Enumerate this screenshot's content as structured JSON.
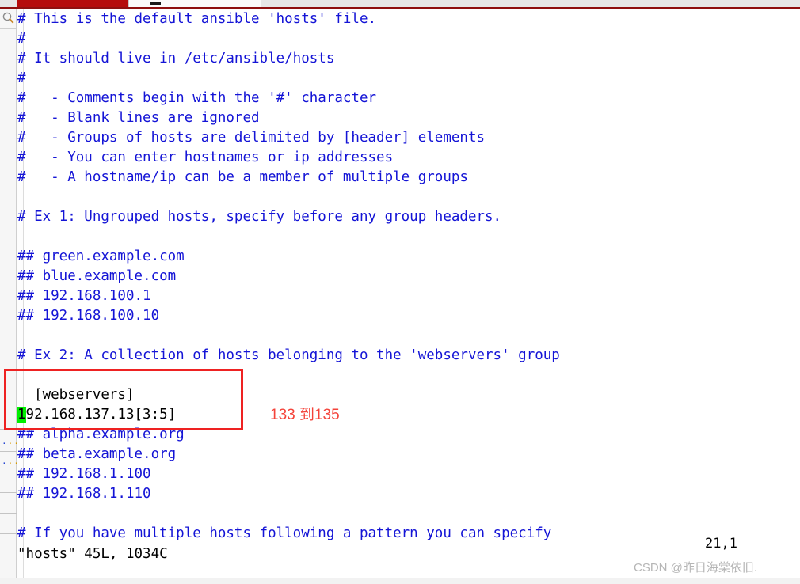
{
  "window": {
    "tab_bar": {
      "active_tab_label": "",
      "inactive_tab_label": "",
      "accent_color": "#b50c0c"
    }
  },
  "left_rail": {
    "search_icon_name": "magnifier-icon",
    "fold_markers": [
      "...",
      "..."
    ]
  },
  "editor": {
    "file_type": "ansible-hosts",
    "text_color": "#1414d6",
    "edited_text_color": "#000000",
    "cursor_color": "#00ef00",
    "lines": [
      {
        "text": "# This is the default ansible 'hosts' file.",
        "color": "blue"
      },
      {
        "text": "#",
        "color": "blue"
      },
      {
        "text": "# It should live in /etc/ansible/hosts",
        "color": "blue"
      },
      {
        "text": "#",
        "color": "blue"
      },
      {
        "text": "#   - Comments begin with the '#' character",
        "color": "blue"
      },
      {
        "text": "#   - Blank lines are ignored",
        "color": "blue"
      },
      {
        "text": "#   - Groups of hosts are delimited by [header] elements",
        "color": "blue"
      },
      {
        "text": "#   - You can enter hostnames or ip addresses",
        "color": "blue"
      },
      {
        "text": "#   - A hostname/ip can be a member of multiple groups",
        "color": "blue"
      },
      {
        "text": "",
        "color": "blue"
      },
      {
        "text": "# Ex 1: Ungrouped hosts, specify before any group headers.",
        "color": "blue"
      },
      {
        "text": "",
        "color": "blue"
      },
      {
        "text": "## green.example.com",
        "color": "blue"
      },
      {
        "text": "## blue.example.com",
        "color": "blue"
      },
      {
        "text": "## 192.168.100.1",
        "color": "blue"
      },
      {
        "text": "## 192.168.100.10",
        "color": "blue"
      },
      {
        "text": "",
        "color": "blue"
      },
      {
        "text": "# Ex 2: A collection of hosts belonging to the 'webservers' group",
        "color": "blue"
      },
      {
        "text": "",
        "color": "blue"
      },
      {
        "text": "  [webservers]",
        "color": "black"
      },
      {
        "text": "192.168.137.13[3:5]",
        "color": "black",
        "cursor_at": 0
      },
      {
        "text": "## alpha.example.org",
        "color": "blue"
      },
      {
        "text": "## beta.example.org",
        "color": "blue"
      },
      {
        "text": "## 192.168.1.100",
        "color": "blue"
      },
      {
        "text": "## 192.168.1.110",
        "color": "blue"
      },
      {
        "text": "",
        "color": "blue"
      },
      {
        "text": "# If you have multiple hosts following a pattern you can specify",
        "color": "blue"
      }
    ]
  },
  "annotation": {
    "box_color": "#ee2222",
    "label": "133 到135",
    "label_color": "#f4433a"
  },
  "status": {
    "file_info": "\"hosts\" 45L, 1034C",
    "cursor_position": "21,1"
  },
  "watermark": {
    "text": "CSDN @昨日海棠依旧."
  }
}
